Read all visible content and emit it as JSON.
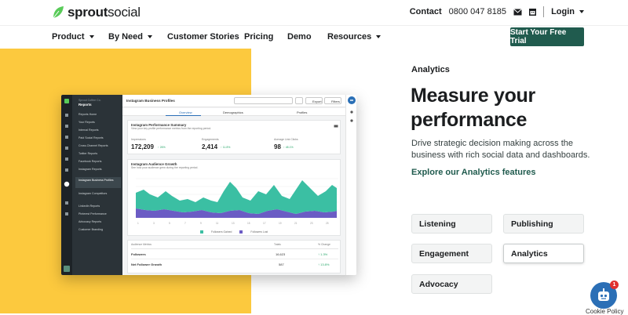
{
  "header": {
    "logo_text_bold": "sprout",
    "logo_text_light": "social",
    "contact_label": "Contact",
    "phone": "0800 047 8185",
    "login_label": "Login"
  },
  "nav": {
    "items": [
      {
        "label": "Product",
        "has_caret": true
      },
      {
        "label": "By Need",
        "has_caret": true
      },
      {
        "label": "Customer Stories",
        "has_caret": false
      },
      {
        "label": "Pricing",
        "has_caret": false
      },
      {
        "label": "Demo",
        "has_caret": false
      },
      {
        "label": "Resources",
        "has_caret": true
      }
    ],
    "cta_label": "Start Your Free Trial"
  },
  "hero": {
    "eyebrow": "Analytics",
    "headline_line1": "Measure your",
    "headline_line2": "performance",
    "description": "Drive strategic decision making across the business with rich social data and dashboards.",
    "link_label": "Explore our Analytics features",
    "pills": [
      {
        "label": "Listening",
        "active": false
      },
      {
        "label": "Publishing",
        "active": false
      },
      {
        "label": "Engagement",
        "active": false
      },
      {
        "label": "Analytics",
        "active": true
      },
      {
        "label": "Advocacy",
        "active": false
      }
    ]
  },
  "mockup": {
    "sidebar_title": "Reports",
    "sidebar_items": [
      "Reports Home",
      "Your Reports",
      "Internal Reports",
      "Paid Social Reports",
      "Cross-Channel Reports",
      "Twitter Reports",
      "Facebook Reports",
      "Instagram Reports",
      "Instagram Business Profiles",
      "Instagram Competitors",
      "LinkedIn Reports",
      "Pinterest Performance",
      "Advocacy Reports",
      "Customer Branding"
    ],
    "page_title": "Instagram Business Profiles",
    "export_label": "Export",
    "filters_label": "Filters",
    "tabs": [
      "Overview",
      "Demographics",
      "Profiles"
    ],
    "summary_title": "Instagram Performance Summary",
    "summary_subtitle": "View your key profile performance metrics from the reporting period.",
    "metrics": [
      {
        "label": "Impressions",
        "value": "172,209",
        "change": "↑ 26%"
      },
      {
        "label": "Engagements",
        "value": "2,414",
        "change": "↑ 11.8%"
      },
      {
        "label": "Average Link Clicks",
        "value": "98",
        "change": "↑ 48.1%"
      }
    ],
    "growth_title": "Instagram Audience Growth",
    "growth_subtitle": "See how your audience grew during the reporting period.",
    "legend": [
      "Followers Gained",
      "Followers Lost"
    ],
    "table_header": [
      "Audience Metrics",
      "Totals",
      "% Change"
    ],
    "table_rows": [
      {
        "label": "Followers",
        "total": "16,623",
        "change": "↑ 1.3%"
      },
      {
        "label": "Net Follower Growth",
        "total": "587",
        "change": "↑ 13.8%"
      }
    ],
    "colors": {
      "gained": "#3bbfa3",
      "lost": "#6b5cc4"
    }
  },
  "chat": {
    "badge_count": "1",
    "cookie_label": "Cookie Policy"
  }
}
